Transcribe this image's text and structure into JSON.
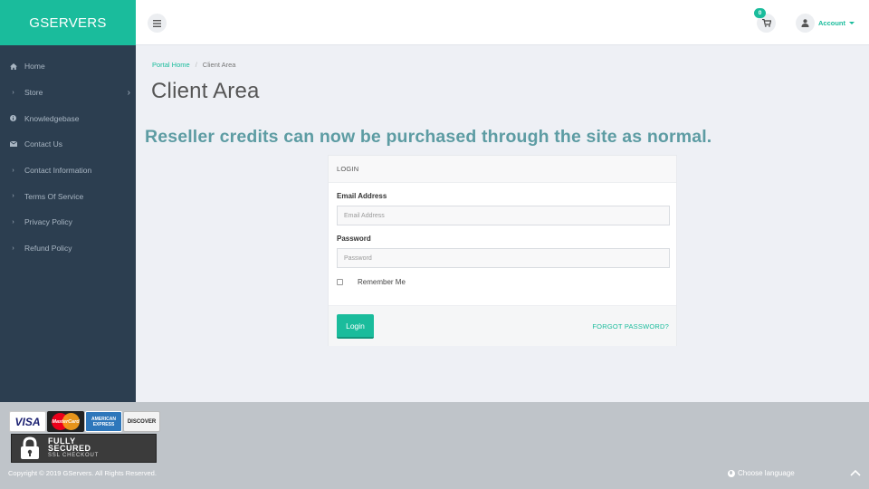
{
  "brand": {
    "name": "GSERVERS"
  },
  "header": {
    "cart_count": "0",
    "account_label": "Account"
  },
  "sidebar": {
    "items": [
      {
        "label": "Home",
        "icon": "home-icon"
      },
      {
        "label": "Store",
        "icon": "chevron-right-icon",
        "has_submenu": true
      },
      {
        "label": "Knowledgebase",
        "icon": "info-icon"
      },
      {
        "label": "Contact Us",
        "icon": "envelope-icon"
      },
      {
        "label": "Contact Information",
        "icon": "chevron-right-icon"
      },
      {
        "label": "Terms Of Service",
        "icon": "chevron-right-icon"
      },
      {
        "label": "Privacy Policy",
        "icon": "chevron-right-icon"
      },
      {
        "label": "Refund Policy",
        "icon": "chevron-right-icon"
      }
    ]
  },
  "breadcrumb": {
    "home": "Portal Home",
    "separator": "/",
    "current": "Client Area"
  },
  "page": {
    "title": "Client Area",
    "announcement": "Reseller credits can now be purchased through the site as normal."
  },
  "login": {
    "heading": "LOGIN",
    "email_label": "Email Address",
    "email_placeholder": "Email Address",
    "password_label": "Password",
    "password_placeholder": "Password",
    "remember_label": "Remember Me",
    "submit_label": "Login",
    "forgot_label": "FORGOT PASSWORD?"
  },
  "footer": {
    "cards": [
      "VISA",
      "MasterCard",
      "AMERICAN EXPRESS",
      "DISCOVER"
    ],
    "ssl_line1": "FULLY",
    "ssl_line2": "SECURED",
    "ssl_line3": "SSL CHECKOUT",
    "copyright": "Copyright © 2019 GServers. All Rights Reserved.",
    "choose_language": "Choose language"
  },
  "colors": {
    "accent": "#1abc9c",
    "sidebar_bg": "#2c3e50",
    "announcement": "#5d9ca3",
    "footer_bg": "#bfc4c9",
    "page_bg": "#eef0f5"
  }
}
